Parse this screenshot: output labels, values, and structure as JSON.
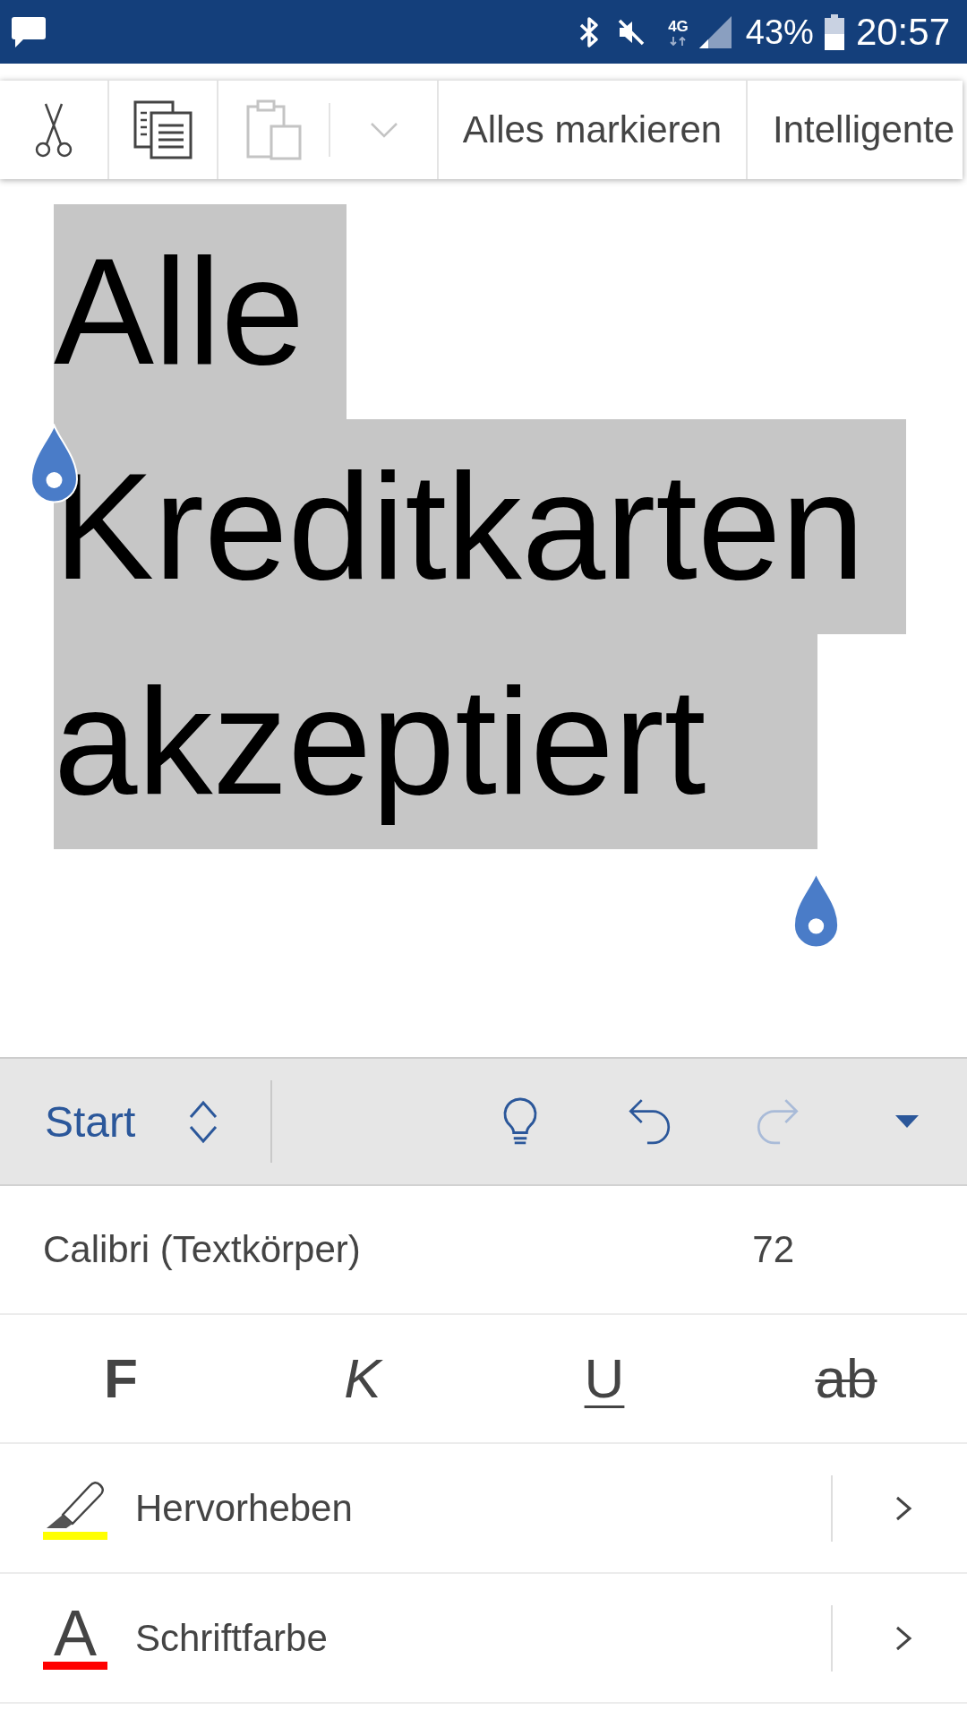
{
  "status_bar": {
    "network": "4G",
    "battery": "43%",
    "time": "20:57"
  },
  "selection_toolbar": {
    "icon_buttons": [
      {
        "kind": "cut",
        "disabled": false
      },
      {
        "kind": "copy",
        "disabled": false
      },
      {
        "kind": "paste",
        "disabled": true
      },
      {
        "kind": "paste_options",
        "disabled": true
      }
    ],
    "text_buttons": [
      "Alles markieren",
      "Intelligente"
    ]
  },
  "document": {
    "text": "Alle Kreditkarten akzeptiert",
    "selected": true
  },
  "ribbon": {
    "tab": "Start",
    "actions": [
      {
        "kind": "tell_me",
        "disabled": false
      },
      {
        "kind": "undo",
        "disabled": false
      },
      {
        "kind": "redo",
        "disabled": true
      },
      {
        "kind": "more",
        "disabled": false
      }
    ]
  },
  "font": {
    "name": "Calibri (Textkörper)",
    "size": "72"
  },
  "format_buttons": [
    {
      "kind": "bold",
      "label": "F"
    },
    {
      "kind": "italic",
      "label": "K"
    },
    {
      "kind": "underline",
      "label": "U"
    },
    {
      "kind": "strikethrough",
      "label": "ab"
    }
  ],
  "color_rows": [
    {
      "kind": "highlight",
      "label": "Hervorheben",
      "color": "#ffff00"
    },
    {
      "kind": "font_color",
      "label": "Schriftfarbe",
      "glyph": "A",
      "color": "#ff0000"
    }
  ]
}
